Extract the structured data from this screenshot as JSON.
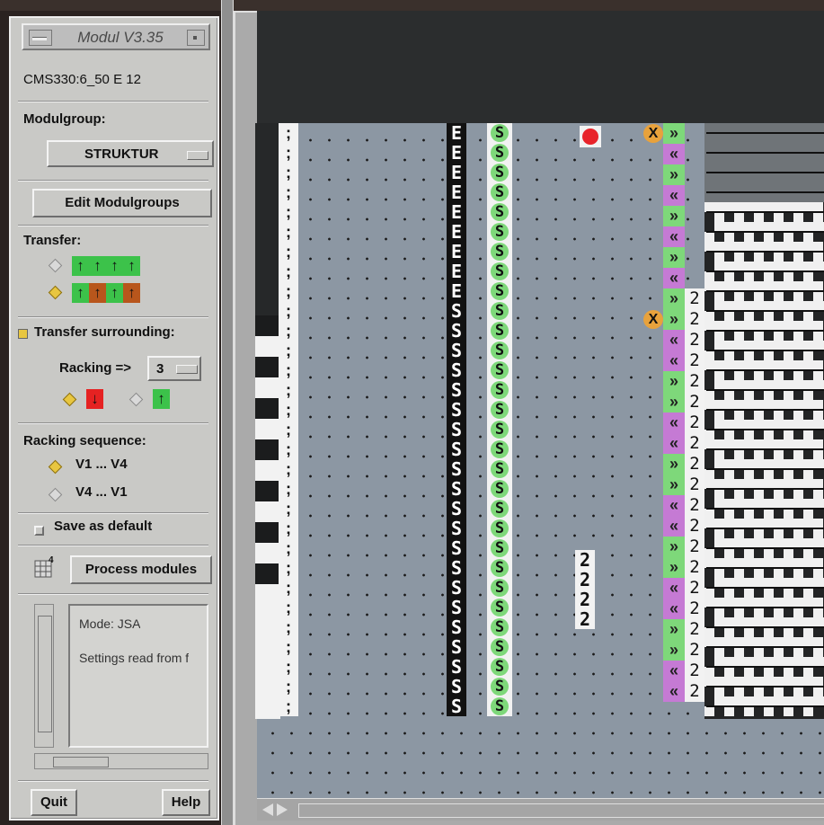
{
  "panel": {
    "title": "Modul V3.35",
    "machine": "CMS330:6_50  E 12",
    "modulgroup_label": "Modulgroup:",
    "modulgroup_value": "STRUKTUR",
    "edit_modulgroups": "Edit Modulgroups",
    "transfer_label": "Transfer:",
    "transfer_option1": {
      "selected": false,
      "arrows": [
        "↑",
        "↑",
        "↑",
        "↑"
      ],
      "colors": [
        "#3cc24a",
        "#3cc24a",
        "#3cc24a",
        "#3cc24a"
      ]
    },
    "transfer_option2": {
      "selected": true,
      "arrows": [
        "↑",
        "↑",
        "↑",
        "↑"
      ],
      "colors": [
        "#3cc24a",
        "#b8561c",
        "#3cc24a",
        "#b8561c"
      ]
    },
    "transfer_surrounding": {
      "label": "Transfer surrounding:",
      "checked": true
    },
    "racking_label": "Racking =>",
    "racking_value": "3",
    "racking_dir1": {
      "selected": true,
      "arrow": "↓",
      "color": "#e52222"
    },
    "racking_dir2": {
      "selected": false,
      "arrow": "↑",
      "color": "#3cc24a"
    },
    "racking_sequence_label": "Racking sequence:",
    "seq_option1": {
      "label": "V1 ... V4",
      "selected": true
    },
    "seq_option2": {
      "label": "V4 ... V1",
      "selected": false
    },
    "save_default": "Save as default",
    "process_icon_num": "4",
    "process_modules": "Process modules",
    "log_lines": [
      "Mode: JSA",
      "Settings read from f"
    ],
    "quit": "Quit",
    "help": "Help"
  },
  "workspace": {
    "col_semicolon": ";",
    "col_e": "E",
    "col_s": "S",
    "col_green_s": "S",
    "col_two": "2",
    "marker_x": "X",
    "chevron_right": "»",
    "chevron_left": "«",
    "colors": {
      "green": "#7ed87a",
      "magenta": "#c57ad4",
      "orange": "#e8a23c",
      "red": "#e8232a",
      "grid": "#8c97a3"
    }
  }
}
